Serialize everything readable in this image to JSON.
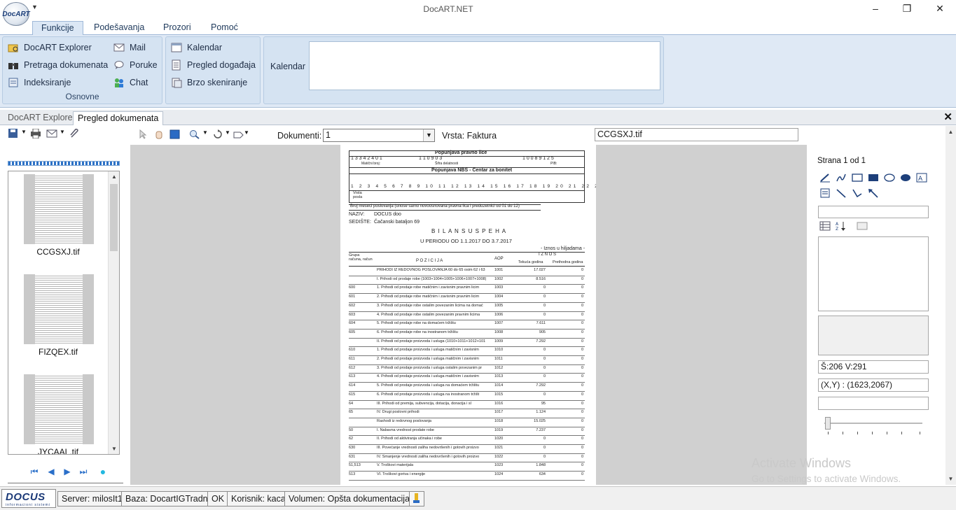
{
  "window": {
    "title": "DocART.NET"
  },
  "app_logo": "DocART",
  "ribbon": {
    "tabs": [
      "Funkcije",
      "Podešavanja",
      "Prozori",
      "Pomoć"
    ],
    "groups": {
      "osnovne": {
        "label": "Osnovne",
        "items": [
          "DocART Explorer",
          "Pretraga dokumenata",
          "Indeksiranje",
          "Mail",
          "Poruke",
          "Chat"
        ]
      },
      "second": {
        "items": [
          "Kalendar",
          "Pregled događaja",
          "Brzo skeniranje"
        ]
      },
      "kalendar": {
        "label": "Kalendar"
      }
    }
  },
  "doc_tabs": [
    "DocART Explorer",
    "Pregled dokumenata"
  ],
  "thumbnails": [
    {
      "label": "CCGSXJ.tif"
    },
    {
      "label": "FIZQEX.tif"
    },
    {
      "label": "JYCAAL.tif"
    }
  ],
  "toolbar": {
    "dokumenti_label": "Dokumenti:",
    "dokumenti_value": "1",
    "vrsta": "Vrsta: Faktura",
    "file_name": "CCGSXJ.tif"
  },
  "document": {
    "header1": "Popunjava pravno lice",
    "header2": "Popunjava NBS - Centar za bonitet",
    "maticni": "Matični broj:",
    "sifra": "Šifra delatnosti",
    "pib": "PIB:",
    "naziv_label": "NAZIV:",
    "naziv": "DOCUS doo",
    "sediste_label": "SEDIŠTE:",
    "sediste": "Čačanski bataljon 69",
    "title": "B I L A N S   U S P E H A",
    "period": "U PERIODU OD 1.1.2017 DO 3.7.2017",
    "iznos_note": "- Iznos u hiljadama -",
    "col_grupa": "Grupa računa, račun",
    "col_pozicija": "P O Z I C I J A",
    "col_aop": "AOP",
    "col_iznos": "I Z N O S",
    "col_tekuca": "Tekuća godina",
    "col_prethodna": "Prethodna godina",
    "rows": [
      {
        "g": "",
        "p": "PRIHODI IZ REDOVNOG POSLOVANJA 60 do 65 osim 62 i 63",
        "a": "1001",
        "t": "17.027",
        "pr": "0"
      },
      {
        "g": "",
        "p": "I. Prihodi od prodaje robe (1003+1004+1005+1006+1007+1008)",
        "a": "1002",
        "t": "8.516",
        "pr": "0"
      },
      {
        "g": "600",
        "p": "1. Prihodi od prodaje robe matičnim i zavisnim pravnim licim",
        "a": "1003",
        "t": "0",
        "pr": "0"
      },
      {
        "g": "601",
        "p": "2. Prihodi od prodaje robe matičnim i zavisnim pravnim licim",
        "a": "1004",
        "t": "0",
        "pr": "0"
      },
      {
        "g": "602",
        "p": "3. Prihodi od prodaje robe ostalim povezanim licima na domać",
        "a": "1005",
        "t": "0",
        "pr": "0"
      },
      {
        "g": "603",
        "p": "4. Prihodi od prodaje robe ostalim povezanim pravnim licima",
        "a": "1006",
        "t": "0",
        "pr": "0"
      },
      {
        "g": "604",
        "p": "5. Prihodi od prodaje robe na domaćem tržištu",
        "a": "1007",
        "t": "7.611",
        "pr": "0"
      },
      {
        "g": "605",
        "p": "6. Prihodi od prodaje robe na inostranom tržištu",
        "a": "1008",
        "t": "905",
        "pr": "0"
      },
      {
        "g": "",
        "p": "II. Prihodi od prodaje proizvoda i usluga (1010+1011+1012+101",
        "a": "1009",
        "t": "7.292",
        "pr": "0"
      },
      {
        "g": "610",
        "p": "1. Prihodi od prodaje proizvoda i usluga matičnim i zavisnim",
        "a": "1010",
        "t": "0",
        "pr": "0"
      },
      {
        "g": "611",
        "p": "2. Prihodi od prodaje proizvoda i usluga matičnim i zavisnim",
        "a": "1011",
        "t": "0",
        "pr": "0"
      },
      {
        "g": "612",
        "p": "3. Prihodi od prodaje proizvoda i usluga ostalim povezanim pr",
        "a": "1012",
        "t": "0",
        "pr": "0"
      },
      {
        "g": "613",
        "p": "4. Prihodi od prodaje proizvoda i usluga matičnim i zavisnim",
        "a": "1013",
        "t": "0",
        "pr": "0"
      },
      {
        "g": "614",
        "p": "5. Prihodi od prodaje proizvoda i usluga na domaćem tržištu",
        "a": "1014",
        "t": "7.292",
        "pr": "0"
      },
      {
        "g": "615",
        "p": "6. Prihodi od prodaje proizvoda i usluga na inostranom tržišt",
        "a": "1015",
        "t": "0",
        "pr": "0"
      },
      {
        "g": "64",
        "p": "III. Prihodi od premija, subvencija, dotacija, donacija i sl",
        "a": "1016",
        "t": "95",
        "pr": "0"
      },
      {
        "g": "65",
        "p": "IV. Drugi poslovni prihodi",
        "a": "1017",
        "t": "1.124",
        "pr": "0"
      },
      {
        "g": "",
        "p": "Rashodi iz redovnog poslovanja",
        "a": "1018",
        "t": "15.025",
        "pr": "0"
      },
      {
        "g": "50",
        "p": "I. Nabavna vrednost prodate robe",
        "a": "1019",
        "t": "7.237",
        "pr": "0"
      },
      {
        "g": "62",
        "p": "II. Prihodi od aktiviranja učinaka i robe",
        "a": "1020",
        "t": "0",
        "pr": "0"
      },
      {
        "g": "630",
        "p": "III. Povećanje vrednosti zaliha nedovršenih i gotovih proizvo",
        "a": "1021",
        "t": "0",
        "pr": "0"
      },
      {
        "g": "631",
        "p": "IV. Smanjenje vrednosti zaliha nedovršenih i gotovih proizvo",
        "a": "1022",
        "t": "0",
        "pr": "0"
      },
      {
        "g": "51,513",
        "p": "V. Troškovi materijala",
        "a": "1023",
        "t": "1.848",
        "pr": "0"
      },
      {
        "g": "513",
        "p": "VI. Troškovi goriva i energije",
        "a": "1024",
        "t": "634",
        "pr": "0"
      }
    ]
  },
  "right_panel": {
    "page_info": "Strana 1 od 1",
    "dimensions": "Š:206  V:291",
    "coords": "(X,Y) : (1623,2067)"
  },
  "watermark": {
    "line1": "Activate Windows",
    "line2": "Go to Settings to activate Windows."
  },
  "statusbar": {
    "logo": "DOCUS",
    "logo_tag": "informacioni sistemi",
    "server": "Server: milosIt1",
    "baza": "Baza: DocartIGTradna",
    "ok": "OK",
    "korisnik": "Korisnik: kaca",
    "volumen": "Volumen: Opšta dokumentacija"
  },
  "colors": {
    "accent": "#1e395b",
    "ribbon_bg": "#dfe9f5",
    "progress": "#2c72c7"
  }
}
